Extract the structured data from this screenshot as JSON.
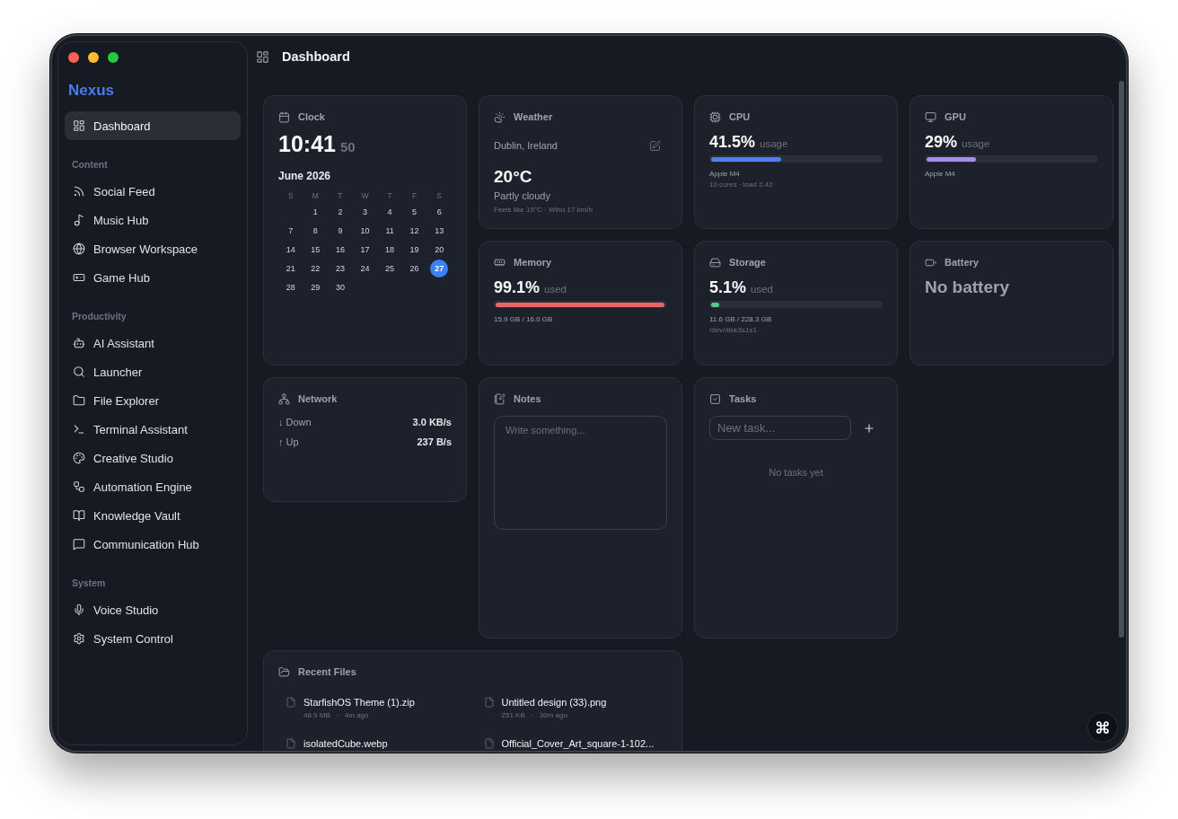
{
  "window": {
    "traffic_lights": [
      {
        "color": "#ff5f57"
      },
      {
        "color": "#febc2e"
      },
      {
        "color": "#28c840"
      }
    ]
  },
  "sidebar": {
    "brand": "Nexus",
    "sections": [
      {
        "items": [
          {
            "label": "Dashboard",
            "selected": true
          }
        ]
      },
      {
        "title": "Content",
        "items": [
          {
            "label": "Social Feed",
            "selected": false
          },
          {
            "label": "Music Hub",
            "selected": false
          },
          {
            "label": "Browser Workspace",
            "selected": false
          },
          {
            "label": "Game Hub",
            "selected": false
          }
        ]
      },
      {
        "title": "Productivity",
        "items": [
          {
            "label": "AI Assistant",
            "selected": false
          },
          {
            "label": "Launcher",
            "selected": false
          },
          {
            "label": "File Explorer",
            "selected": false
          },
          {
            "label": "Terminal Assistant",
            "selected": false
          },
          {
            "label": "Creative Studio",
            "selected": false
          },
          {
            "label": "Automation Engine",
            "selected": false
          },
          {
            "label": "Knowledge Vault",
            "selected": false
          },
          {
            "label": "Communication Hub",
            "selected": false
          }
        ]
      },
      {
        "title": "System",
        "items": [
          {
            "label": "Voice Studio",
            "selected": false
          },
          {
            "label": "System Control",
            "selected": false
          }
        ]
      }
    ]
  },
  "header": {
    "title": "Dashboard"
  },
  "widgets": [
    {
      "kind": "clock",
      "title": "Clock",
      "time": "10:41",
      "seconds": "50",
      "month": "June 2026",
      "weekdays": [
        "S",
        "M",
        "T",
        "W",
        "T",
        "F",
        "S"
      ],
      "weeks": [
        [
          {
            "day": "1",
            "selected": false
          },
          {
            "day": "2",
            "selected": false
          },
          {
            "day": "3",
            "selected": false
          },
          {
            "day": "4",
            "selected": false
          },
          {
            "day": "5",
            "selected": false
          },
          {
            "day": "6",
            "selected": false
          }
        ],
        [
          {
            "day": "7",
            "selected": false
          },
          {
            "day": "8",
            "selected": false
          },
          {
            "day": "9",
            "selected": false
          },
          {
            "day": "10",
            "selected": false
          },
          {
            "day": "11",
            "selected": false
          },
          {
            "day": "12",
            "selected": false
          },
          {
            "day": "13",
            "selected": false
          }
        ],
        [
          {
            "day": "14",
            "selected": false
          },
          {
            "day": "15",
            "selected": false
          },
          {
            "day": "16",
            "selected": false
          },
          {
            "day": "17",
            "selected": false
          },
          {
            "day": "18",
            "selected": false
          },
          {
            "day": "19",
            "selected": false
          },
          {
            "day": "20",
            "selected": false
          }
        ],
        [
          {
            "day": "21",
            "selected": false
          },
          {
            "day": "22",
            "selected": false
          },
          {
            "day": "23",
            "selected": false
          },
          {
            "day": "24",
            "selected": false
          },
          {
            "day": "25",
            "selected": false
          },
          {
            "day": "26",
            "selected": false
          },
          {
            "day": "27",
            "selected": true
          }
        ],
        [
          {
            "day": "28",
            "selected": false
          },
          {
            "day": "29",
            "selected": false
          },
          {
            "day": "30",
            "selected": false
          }
        ]
      ]
    },
    {
      "kind": "weather",
      "title": "Weather",
      "location": "Dublin, Ireland",
      "temperature": "20°C",
      "condition": "Partly cloudy",
      "details": "Feels like 19°C · Wind 17 km/h"
    },
    {
      "kind": "meter",
      "title": "CPU",
      "value": "41.5%",
      "unit": "usage",
      "level": 0.415,
      "color": "#4f80f2",
      "details": [
        "Apple M4",
        "10 cores · load 2.42"
      ]
    },
    {
      "kind": "meter",
      "title": "GPU",
      "value": "29%",
      "unit": "usage",
      "level": 0.29,
      "color": "#a78bfa",
      "details": [
        "Apple M4"
      ]
    },
    {
      "kind": "meter",
      "title": "Memory",
      "value": "99.1%",
      "unit": "used",
      "level": 0.991,
      "color": "#ec6464",
      "details": [
        "15.9 GB / 16.0 GB"
      ]
    },
    {
      "kind": "meter",
      "title": "Storage",
      "value": "5.1%",
      "unit": "used",
      "level": 0.051,
      "color": "#4fd08a",
      "details": [
        "11.6 GB / 228.3 GB",
        "/dev/disk3s1s1"
      ]
    },
    {
      "kind": "status",
      "title": "Battery",
      "message": "No battery"
    },
    {
      "kind": "network",
      "title": "Network",
      "rows": [
        {
          "label": "↓ Down",
          "value": "3.0 KB/s"
        },
        {
          "label": "↑ Up",
          "value": "237 B/s"
        }
      ]
    },
    {
      "kind": "notes",
      "title": "Notes",
      "placeholder": "Write something..."
    },
    {
      "kind": "tasks",
      "title": "Tasks",
      "placeholder": "New task...",
      "empty_message": "No tasks yet"
    },
    {
      "kind": "files",
      "title": "Recent Files",
      "files": [
        {
          "name": "StarfishOS Theme (1).zip",
          "meta": "48.9 MB   ·   4m ago"
        },
        {
          "name": "Untitled design (33).png",
          "meta": "251 KB   ·   30m ago"
        },
        {
          "name": "isolatedCube.webp"
        },
        {
          "name": "Official_Cover_Art_square-1-102..."
        }
      ]
    }
  ]
}
